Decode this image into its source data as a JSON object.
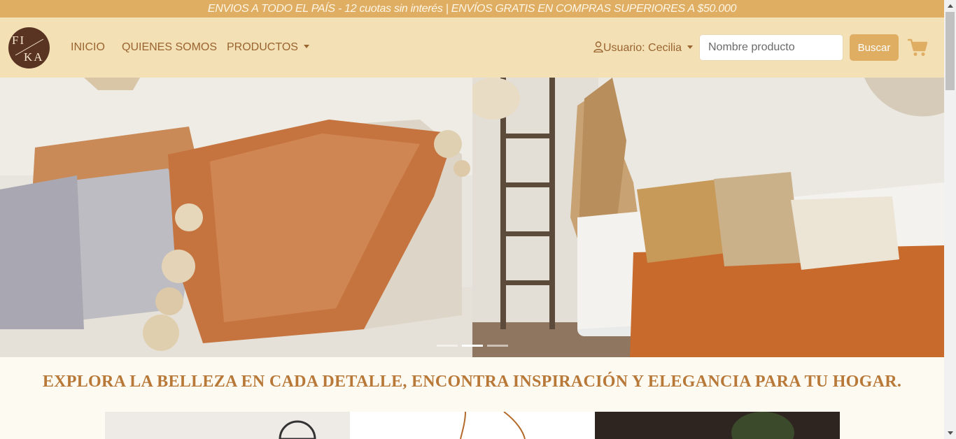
{
  "promo_bar": {
    "text": "ENVIOS A TODO EL PAÍS - 12 cuotas sin interés | ENVÍOS GRATIS EN COMPRAS SUPERIORES A $50.000"
  },
  "navbar": {
    "logo": {
      "line1": "FI",
      "line2": "KA"
    },
    "links": [
      {
        "label": "INICIO"
      },
      {
        "label": "QUIENES SOMOS"
      },
      {
        "label": "PRODUCTOS"
      }
    ],
    "user_label": "Usuario: Cecilia",
    "search": {
      "placeholder": "Nombre producto",
      "value": ""
    },
    "search_button": "Buscar"
  },
  "carousel": {
    "slides": [
      {
        "description": "orange and grey cushions with tassels"
      },
      {
        "description": "sofa with orange throw, cushions and pampas"
      }
    ],
    "indicator_count": 3,
    "active_index": 1
  },
  "tagline": "EXPLORA LA BELLEZA EN CADA DETALLE, ENCONTRA INSPIRACIÓN Y ELEGANCIA PARA TU HOGAR.",
  "colors": {
    "promo_bg": "#dfae63",
    "navbar_bg": "#f3e0b5",
    "link": "#9a6430",
    "button": "#dfae63",
    "tagline": "#b87838",
    "page_bg": "#fdfaf1"
  }
}
